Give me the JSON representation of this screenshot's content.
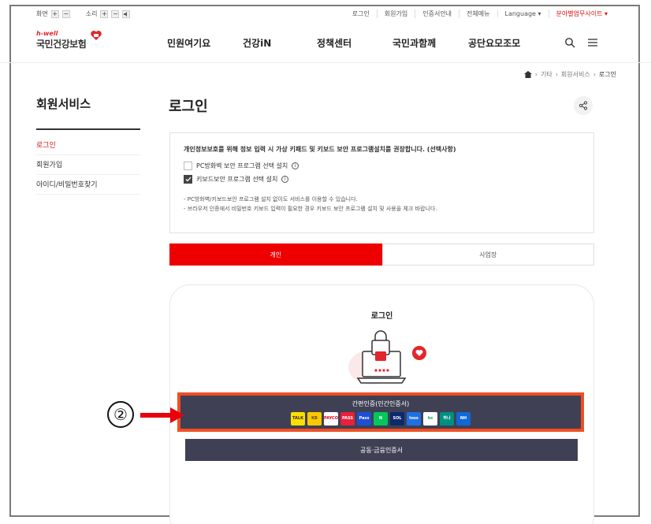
{
  "utility": {
    "screen_label": "화면",
    "sound_label": "소리",
    "plus": "+",
    "minus": "−",
    "links": [
      "로그인",
      "회원가입",
      "인증서안내",
      "전체메뉴",
      "Language ▾"
    ],
    "related_sites": "분야별업무사이트 ▾"
  },
  "logo": {
    "top": "h-well",
    "main": "국민건강보험"
  },
  "gnb": [
    "민원여기요",
    "건강iN",
    "정책센터",
    "국민과함께",
    "공단요모조모"
  ],
  "breadcrumb": [
    "기타",
    "회원서비스",
    "로그인"
  ],
  "sidebar": {
    "title": "회원서비스",
    "items": [
      "로그인",
      "회원가입",
      "아이디/비밀번호찾기"
    ]
  },
  "page_title": "로그인",
  "notice": {
    "head": "개인정보보호를 위해 정보 입력 시 가상 키패드 및 키보드 보안 프로그램설치를 권장합니다. (선택사항)",
    "options": [
      {
        "label": "PC방화벽 보안 프로그램 선택 설치",
        "checked": false
      },
      {
        "label": "키보드보안 프로그램 선택 설치",
        "checked": true
      }
    ],
    "notes": [
      "- PC방화벽/키보드보안 프로그램 설치 없이도 서비스를 이용할 수 있습니다.",
      "- 브라우저 인증에서 비밀번호 키보드 입력이 필요한 경우 키보드 보안 프로그램 설치 및 사용을 체크 바랍니다."
    ]
  },
  "tabs": [
    "개인",
    "사업장"
  ],
  "login_card": {
    "title": "로그인",
    "easy_button": "간편인증(민간인증서)",
    "cert_button": "공동·금융인증서",
    "providers": [
      {
        "name": "kakao-icon",
        "text": "TALK",
        "bg": "#f9e000",
        "fg": "#3a1d1d"
      },
      {
        "name": "kb-icon",
        "text": "KB",
        "bg": "#f9c800",
        "fg": "#5a4a2a"
      },
      {
        "name": "payco-icon",
        "text": "PAYCO",
        "bg": "#ffffff",
        "fg": "#e3001b"
      },
      {
        "name": "pass-icon",
        "text": "PASS",
        "bg": "#e8203a",
        "fg": "#ffffff"
      },
      {
        "name": "samsung-pass-icon",
        "text": "Pass",
        "bg": "#1d4fd6",
        "fg": "#ffffff"
      },
      {
        "name": "naver-icon",
        "text": "N",
        "bg": "#03c75a",
        "fg": "#ffffff"
      },
      {
        "name": "shinhan-icon",
        "text": "SOL",
        "bg": "#0b2a6b",
        "fg": "#ffffff"
      },
      {
        "name": "toss-icon",
        "text": "toss",
        "bg": "#1f6fe5",
        "fg": "#ffffff"
      },
      {
        "name": "banksalad-icon",
        "text": "bs",
        "bg": "#ffffff",
        "fg": "#17b26a"
      },
      {
        "name": "hana-icon",
        "text": "하나",
        "bg": "#00907f",
        "fg": "#ffffff"
      },
      {
        "name": "nh-icon",
        "text": "NH",
        "bg": "#1068d6",
        "fg": "#ffffff"
      }
    ]
  },
  "annotation": {
    "step": "②"
  },
  "colors": {
    "brand_red": "#ee0000",
    "button_dark": "#3f4054",
    "highlight": "#f04e23"
  }
}
